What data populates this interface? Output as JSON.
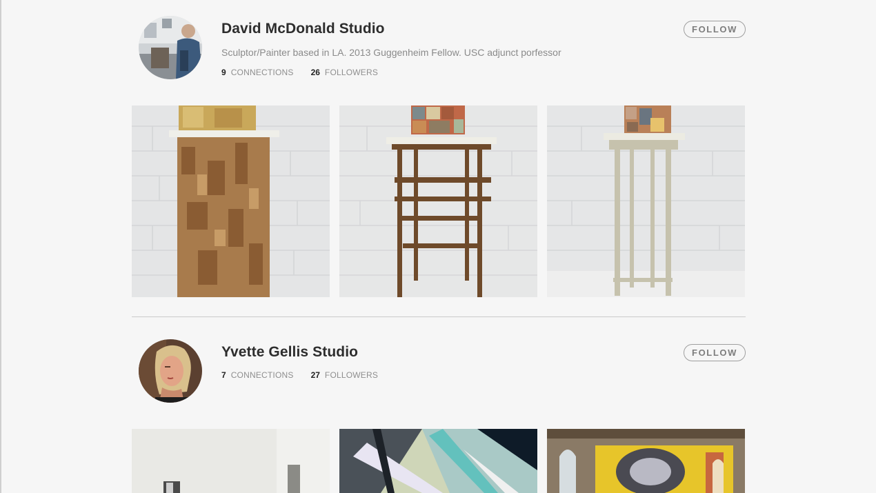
{
  "profiles": [
    {
      "name": "David McDonald Studio",
      "bio": "Sculptor/Painter based in LA. 2013 Guggenheim Fellow. USC adjunct porfessor",
      "connections_count": "9",
      "connections_label": "CONNECTIONS",
      "followers_count": "26",
      "followers_label": "FOLLOWERS",
      "follow_label": "FOLLOW"
    },
    {
      "name": "Yvette Gellis Studio",
      "connections_count": "7",
      "connections_label": "CONNECTIONS",
      "followers_count": "27",
      "followers_label": "FOLLOWERS",
      "follow_label": "FOLLOW"
    }
  ]
}
